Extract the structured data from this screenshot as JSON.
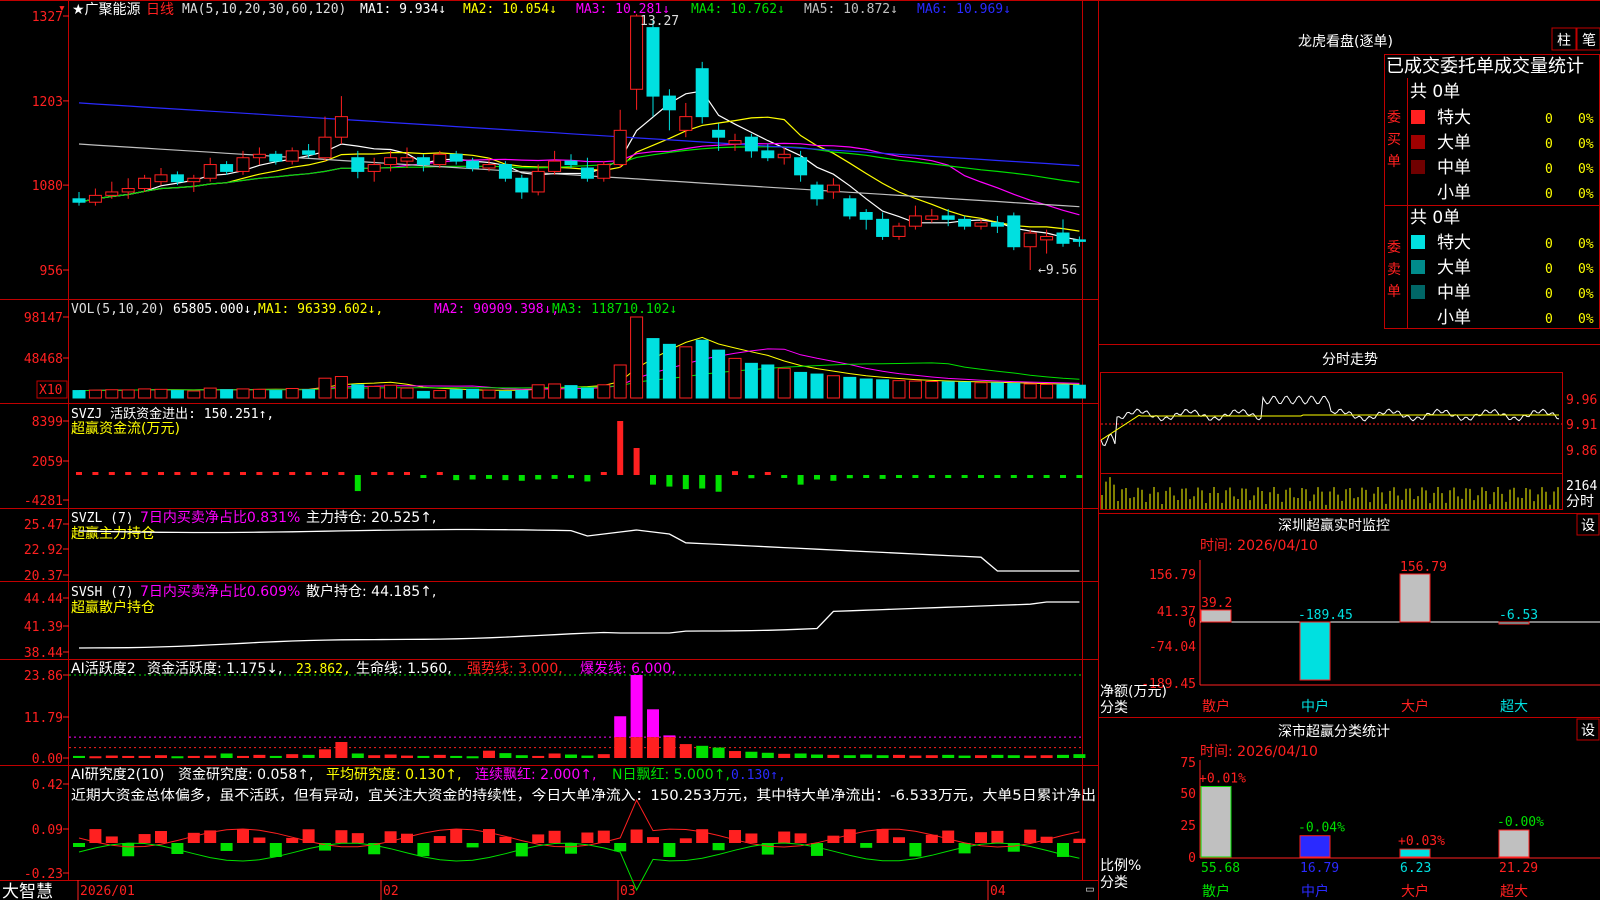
{
  "colors": {
    "up": "#ff2020",
    "down": "#00e0e0",
    "bg": "#000000",
    "frame": "#c00000",
    "yellow": "#ffff00",
    "magenta": "#ff00ff",
    "green": "#00e000",
    "blue": "#2a2aff",
    "white": "#ffffff",
    "gray": "#c0c0c0"
  },
  "header": {
    "corner_icon": "▾",
    "title": "★广聚能源",
    "period": "日线"
  },
  "main_panel": {
    "ma_label": "MA(5,10,20,30,60,120)",
    "legend": [
      {
        "name": "MA1",
        "value": "9.934",
        "arrow": "↓",
        "color": "#ffffff"
      },
      {
        "name": "MA2",
        "value": "10.054",
        "arrow": "↓",
        "color": "#ffff00"
      },
      {
        "name": "MA3",
        "value": "10.281",
        "arrow": "↓",
        "color": "#ff00ff"
      },
      {
        "name": "MA4",
        "value": "10.762",
        "arrow": "↓",
        "color": "#00e000"
      },
      {
        "name": "MA5",
        "value": "10.872",
        "arrow": "↓",
        "color": "#c0c0c0"
      },
      {
        "name": "MA6",
        "value": "10.969",
        "arrow": "↓",
        "color": "#2a2aff"
      }
    ],
    "y_ticks": [
      "1327",
      "1203",
      "1080",
      "956"
    ],
    "high_label": "13.27",
    "low_label": "←9.56"
  },
  "vol_panel": {
    "label": "VOL(5,10,20)",
    "value": "65805.000↓,",
    "legend": [
      {
        "text": "MA1: 96339.602↓,",
        "color": "#ffff00"
      },
      {
        "text": "MA2: 90909.398↓,",
        "color": "#ff00ff"
      },
      {
        "text": "MA3: 118710.102↓",
        "color": "#00e000"
      }
    ],
    "y_ticks": [
      "98147",
      "48468"
    ],
    "unit": "X10"
  },
  "svzj_panel": {
    "label": "SVZJ  活跃资金进出: 150.251↑,",
    "sub": "超赢资金流(万元)",
    "y_ticks": [
      "8399",
      "2059",
      "-4281"
    ]
  },
  "svzl_panel": {
    "label": "SVZL (7)",
    "desc": "7日内买卖净占比0.831%",
    "hold": "主力持仓: 20.525↑,",
    "sub": "超赢主力持仓",
    "y_ticks": [
      "25.47",
      "22.92",
      "20.37"
    ]
  },
  "svsh_panel": {
    "label": "SVSH (7)",
    "desc": "7日内买卖净占比0.609%",
    "hold": "散户持仓: 44.185↑,",
    "sub": "超赢散户持仓",
    "y_ticks": [
      "44.44",
      "41.39",
      "38.44"
    ]
  },
  "ai_panel": {
    "label": "AI活跃度2",
    "l1": "资金活跃度: 1.175↓,",
    "l2": "23.862,",
    "l3": "生命线: 1.560,",
    "l4": "强势线: 3.000,",
    "l5": "爆发线: 6.000,",
    "y_ticks": [
      "23.86",
      "11.79",
      "0.00"
    ]
  },
  "ai2_panel": {
    "label": "AI研究度2(10)",
    "l1": "资金研究度: 0.058↑,",
    "l2": "平均研究度: 0.130↑,",
    "l3": "连续飘红: 2.000↑,",
    "l4": "N日飘红: 5.000↑,",
    "l5": "0.130↑,",
    "comment": "近期大资金总体偏多，虽不活跃，但有异动，宜关注大资金的持续性，今日大单净流入：150.253万元，其中特大单净流出：-6.533万元，大单5日累计净出",
    "y_ticks": [
      "0.42",
      "0.09",
      "-0.23"
    ]
  },
  "x_axis": {
    "labels": [
      "2026/01",
      "02",
      "03",
      "04"
    ],
    "logo": "大智慧"
  },
  "right": {
    "lhb_title": "龙虎看盘(逐单)",
    "tab_zhu": "柱",
    "tab_bi": "笔",
    "table_header": "已成交委托单成交量统计",
    "buy_label": "委买单",
    "sell_label": "委卖单",
    "buy_total": "共 0单",
    "sell_total": "共 0单",
    "buy_rows": [
      {
        "name": "特大",
        "count": "0",
        "pct": "0%"
      },
      {
        "name": "大单",
        "count": "0",
        "pct": "0%"
      },
      {
        "name": "中单",
        "count": "0",
        "pct": "0%"
      },
      {
        "name": "小单",
        "count": "0",
        "pct": "0%"
      }
    ],
    "sell_rows": [
      {
        "name": "特大",
        "count": "0",
        "pct": "0%"
      },
      {
        "name": "大单",
        "count": "0",
        "pct": "0%"
      },
      {
        "name": "中单",
        "count": "0",
        "pct": "0%"
      },
      {
        "name": "小单",
        "count": "0",
        "pct": "0%"
      }
    ],
    "intraday_title": "分时走势",
    "intraday_ticks": [
      "9.96",
      "9.91",
      "9.86"
    ],
    "intraday_vol": "2164",
    "intraday_tag": "分时",
    "sz_title": "深圳超赢实时监控",
    "sz_set": "设",
    "sz_date": "时间: 2026/04/10",
    "sz_ticks": [
      "156.79",
      "41.37",
      "0",
      "-74.04",
      "-189.45"
    ],
    "sz_ylabel": "净额(万元)",
    "sz_xlabel": "分类",
    "sz_cats": [
      "散户",
      "中户",
      "大户",
      "超大"
    ],
    "sz_bar_labels": [
      "39.2",
      "-189.45",
      "156.79",
      "-6.53"
    ],
    "cls_title": "深市超赢分类统计",
    "cls_set": "设",
    "cls_date": "时间: 2026/04/10",
    "cls_ticks": [
      "75",
      "50",
      "25",
      "0"
    ],
    "cls_ylabel": "比例%",
    "cls_xlabel": "分类",
    "cls_cats": [
      "散户",
      "中户",
      "大户",
      "超大"
    ],
    "cls_top_labels": [
      "+0.01%",
      "-0.04%",
      "+0.03%",
      "-0.00%"
    ],
    "cls_bot_labels": [
      "55.68",
      "16.79",
      "6.23",
      "21.29"
    ]
  },
  "chart_data": [
    {
      "type": "candlestick",
      "ylim": [
        9.4,
        13.4
      ],
      "y_ticks": [
        13.27,
        12.03,
        10.8,
        9.56
      ],
      "candles": [
        [
          10.6,
          10.55,
          10.7,
          10.5
        ],
        [
          10.55,
          10.65,
          10.75,
          10.5
        ],
        [
          10.65,
          10.7,
          10.85,
          10.6
        ],
        [
          10.7,
          10.75,
          10.9,
          10.6
        ],
        [
          10.75,
          10.9,
          10.95,
          10.7
        ],
        [
          10.85,
          10.95,
          11.05,
          10.8
        ],
        [
          10.95,
          10.85,
          11.0,
          10.8
        ],
        [
          10.85,
          10.9,
          10.95,
          10.7
        ],
        [
          10.9,
          11.1,
          11.2,
          10.85
        ],
        [
          11.1,
          11.0,
          11.15,
          10.95
        ],
        [
          11.0,
          11.2,
          11.3,
          10.95
        ],
        [
          11.2,
          11.25,
          11.35,
          11.1
        ],
        [
          11.25,
          11.15,
          11.3,
          11.1
        ],
        [
          11.15,
          11.3,
          11.35,
          11.1
        ],
        [
          11.3,
          11.25,
          11.4,
          11.2
        ],
        [
          11.2,
          11.5,
          11.8,
          11.15
        ],
        [
          11.5,
          11.8,
          12.1,
          11.4
        ],
        [
          11.2,
          11.0,
          11.3,
          10.9
        ],
        [
          11.0,
          11.1,
          11.2,
          10.85
        ],
        [
          11.1,
          11.2,
          11.3,
          11.0
        ],
        [
          11.15,
          11.2,
          11.35,
          11.05
        ],
        [
          11.2,
          11.1,
          11.25,
          11.0
        ],
        [
          11.1,
          11.25,
          11.3,
          11.05
        ],
        [
          11.25,
          11.15,
          11.3,
          11.1
        ],
        [
          11.15,
          11.05,
          11.2,
          11.0
        ],
        [
          11.05,
          11.1,
          11.2,
          11.0
        ],
        [
          11.1,
          10.9,
          11.15,
          10.85
        ],
        [
          10.9,
          10.7,
          10.95,
          10.6
        ],
        [
          10.7,
          11.0,
          11.1,
          10.65
        ],
        [
          11.0,
          11.15,
          11.3,
          10.95
        ],
        [
          11.15,
          11.1,
          11.25,
          11.05
        ],
        [
          11.05,
          10.9,
          11.2,
          10.85
        ],
        [
          10.9,
          11.1,
          11.15,
          10.85
        ],
        [
          11.1,
          11.6,
          11.9,
          11.05
        ],
        [
          12.2,
          13.27,
          13.3,
          11.9
        ],
        [
          13.1,
          12.1,
          13.2,
          11.8
        ],
        [
          12.1,
          11.9,
          12.2,
          11.6
        ],
        [
          11.6,
          11.8,
          12.0,
          11.5
        ],
        [
          12.5,
          11.8,
          12.6,
          11.7
        ],
        [
          11.6,
          11.5,
          11.7,
          11.3
        ],
        [
          11.4,
          11.45,
          11.55,
          11.3
        ],
        [
          11.5,
          11.3,
          11.55,
          11.2
        ],
        [
          11.3,
          11.2,
          11.4,
          11.15
        ],
        [
          11.2,
          11.25,
          11.35,
          11.1
        ],
        [
          11.2,
          10.95,
          11.3,
          10.85
        ],
        [
          10.8,
          10.6,
          10.85,
          10.5
        ],
        [
          10.7,
          10.8,
          10.9,
          10.6
        ],
        [
          10.6,
          10.35,
          10.65,
          10.3
        ],
        [
          10.4,
          10.3,
          10.45,
          10.15
        ],
        [
          10.3,
          10.05,
          10.4,
          10.0
        ],
        [
          10.05,
          10.2,
          10.25,
          10.0
        ],
        [
          10.2,
          10.35,
          10.5,
          10.15
        ],
        [
          10.3,
          10.35,
          10.45,
          10.25
        ],
        [
          10.35,
          10.3,
          10.45,
          10.2
        ],
        [
          10.3,
          10.2,
          10.35,
          10.15
        ],
        [
          10.2,
          10.25,
          10.3,
          10.15
        ],
        [
          10.25,
          10.2,
          10.35,
          10.1
        ],
        [
          10.35,
          9.9,
          10.4,
          9.85
        ],
        [
          9.9,
          10.1,
          10.15,
          9.56
        ],
        [
          10.0,
          10.05,
          10.15,
          9.8
        ],
        [
          10.1,
          9.95,
          10.3,
          9.9
        ],
        [
          10.0,
          9.98,
          10.05,
          9.9
        ]
      ]
    },
    {
      "type": "bar",
      "name": "VOL",
      "ylim": [
        0,
        110000
      ],
      "values": [
        9000,
        9500,
        10000,
        9800,
        11000,
        10500,
        9000,
        8500,
        12000,
        10000,
        11000,
        10500,
        9000,
        11500,
        10000,
        24000,
        26000,
        16000,
        14000,
        15500,
        12000,
        8000,
        9000,
        10000,
        10500,
        9500,
        8000,
        9000,
        16000,
        17000,
        15000,
        12000,
        16000,
        40000,
        98147,
        72000,
        65000,
        62000,
        70000,
        58000,
        48000,
        42000,
        40000,
        36000,
        31000,
        29000,
        27000,
        25000,
        23000,
        22000,
        21000,
        20500,
        20000,
        19500,
        19000,
        18500,
        18000,
        17500,
        17000,
        16500,
        16000,
        15500
      ]
    },
    {
      "type": "bar",
      "name": "SVZJ",
      "ylim": [
        -4281,
        8399
      ],
      "values": [
        200,
        150,
        180,
        200,
        160,
        150,
        120,
        140,
        150,
        160,
        170,
        180,
        190,
        250,
        300,
        400,
        350,
        -2500,
        300,
        400,
        350,
        -300,
        200,
        -800,
        -700,
        -600,
        -800,
        -900,
        -700,
        -600,
        -500,
        -1000,
        250,
        8399,
        4200,
        -1500,
        -1800,
        -2200,
        -2100,
        -2600,
        600,
        -500,
        200,
        -400,
        -1500,
        -700,
        -900,
        -500,
        -300,
        -600,
        -350,
        -400,
        -300,
        -200,
        -250,
        -300,
        -350,
        -400,
        -300,
        -250,
        -350,
        -200
      ]
    },
    {
      "type": "bar",
      "name": "AI活跃度2",
      "ylim": [
        0,
        23.86
      ],
      "values": [
        0.6,
        0.5,
        0.7,
        0.6,
        0.6,
        0.8,
        0.5,
        0.6,
        0.7,
        1.3,
        0.6,
        0.9,
        0.6,
        1.1,
        0.9,
        2.5,
        4.6,
        1.3,
        0.8,
        1.0,
        0.7,
        0.6,
        0.9,
        0.6,
        0.5,
        2.1,
        1.4,
        0.8,
        0.6,
        1.3,
        1.0,
        0.7,
        1.1,
        12.0,
        23.86,
        14.0,
        6.5,
        4.0,
        3.5,
        3.0,
        2.0,
        1.8,
        1.5,
        1.2,
        1.3,
        1.0,
        0.9,
        0.8,
        1.0,
        0.8,
        0.9,
        0.7,
        0.8,
        0.9,
        0.7,
        0.8,
        0.9,
        0.8,
        0.7,
        0.8,
        0.9,
        1.1
      ]
    }
  ]
}
